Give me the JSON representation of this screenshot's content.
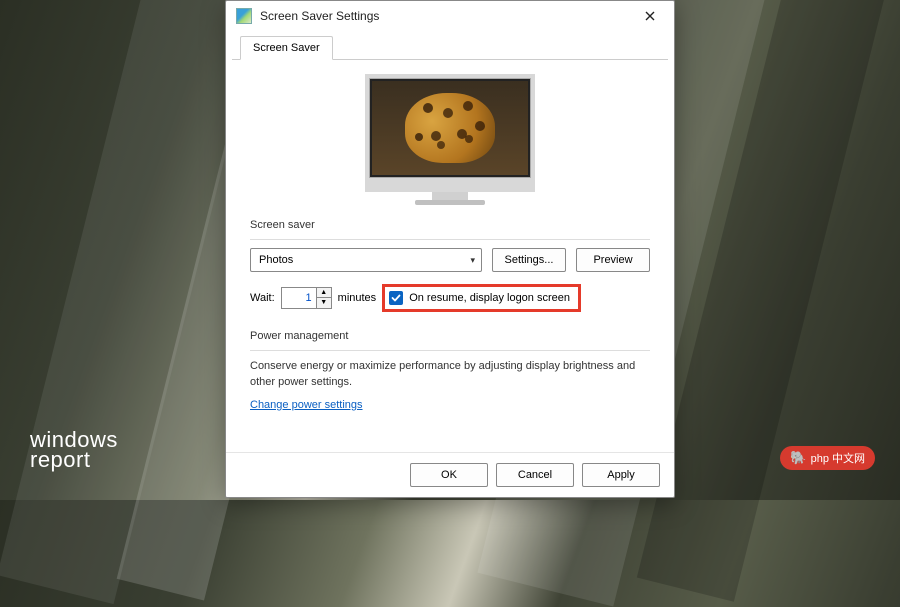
{
  "window": {
    "title": "Screen Saver Settings",
    "tab": "Screen Saver"
  },
  "screensaver": {
    "group_label": "Screen saver",
    "selected": "Photos",
    "settings_button": "Settings...",
    "preview_button": "Preview"
  },
  "wait": {
    "label": "Wait:",
    "value": "1",
    "unit": "minutes",
    "resume_label": "On resume, display logon screen"
  },
  "power": {
    "group_label": "Power management",
    "description": "Conserve energy or maximize performance by adjusting display brightness and other power settings.",
    "link": "Change power settings"
  },
  "buttons": {
    "ok": "OK",
    "cancel": "Cancel",
    "apply": "Apply"
  },
  "watermarks": {
    "left_line1": "windows",
    "left_line2": "report",
    "right": "php 中文网"
  }
}
